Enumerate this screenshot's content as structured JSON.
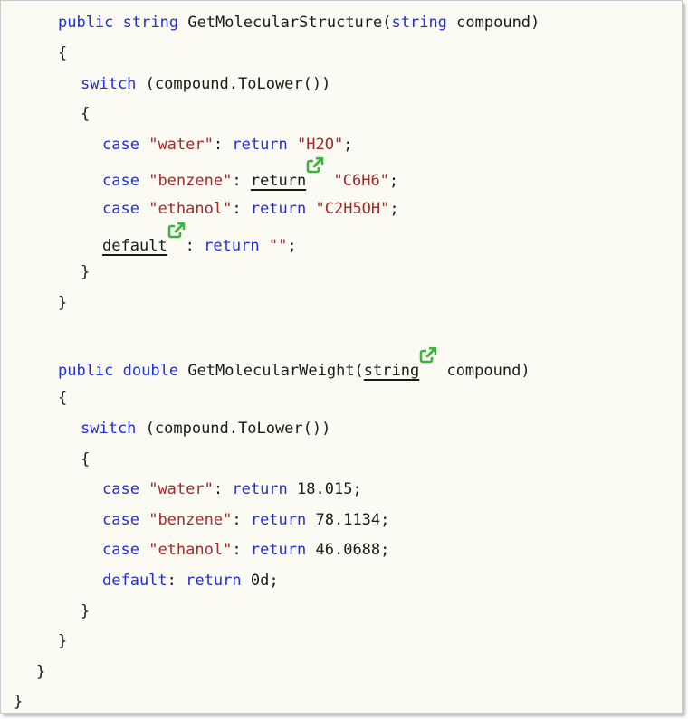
{
  "colors": {
    "keyword": "#1f2fd8",
    "string": "#a52a2a",
    "text": "#1a1a1a",
    "link_icon": "#3cb43c",
    "background": "#fcfbf3"
  },
  "code": {
    "l1": {
      "kw1": "public",
      "kw2": "string",
      "rest": " GetMolecularStructure(",
      "kw3": "string",
      "rest2": " compound)"
    },
    "l2": {
      "text": "{"
    },
    "l3": {
      "kw": "switch",
      "rest": " (compound.ToLower())"
    },
    "l4": {
      "text": "{"
    },
    "l5": {
      "kw_case": "case",
      "str": "\"water\"",
      "colon": ":",
      "kw_ret": "return",
      "val": "\"H2O\"",
      "end": ";"
    },
    "l6": {
      "kw_case": "case",
      "str": "\"benzene\"",
      "colon": ":",
      "kw_ret": "return",
      "val": "\"C6H6\"",
      "end": ";"
    },
    "l7": {
      "kw_case": "case",
      "str": "\"ethanol\"",
      "colon": ":",
      "kw_ret": "return",
      "val": "\"C2H5OH\"",
      "end": ";"
    },
    "l8": {
      "kw_default": "default",
      "colon": ":",
      "kw_ret": "return",
      "val": "\"\"",
      "end": ";"
    },
    "l9": {
      "text": "}"
    },
    "l10": {
      "text": "}"
    },
    "l11": {
      "kw1": "public",
      "kw2": "double",
      "rest": " GetMolecularWeight(",
      "kw3": "string",
      "rest2": " compound)"
    },
    "l12": {
      "text": "{"
    },
    "l13": {
      "kw": "switch",
      "rest": " (compound.ToLower())"
    },
    "l14": {
      "text": "{"
    },
    "l15": {
      "kw_case": "case",
      "str": "\"water\"",
      "colon": ":",
      "kw_ret": "return",
      "val": "18.015",
      "end": ";"
    },
    "l16": {
      "kw_case": "case",
      "str": "\"benzene\"",
      "colon": ":",
      "kw_ret": "return",
      "val": "78.1134",
      "end": ";"
    },
    "l17": {
      "kw_case": "case",
      "str": "\"ethanol\"",
      "colon": ":",
      "kw_ret": "return",
      "val": "46.0688",
      "end": ";"
    },
    "l18": {
      "kw_default": "default",
      "colon": ":",
      "kw_ret": "return",
      "val": "0d",
      "end": ";"
    },
    "l19": {
      "text": "}"
    },
    "l20": {
      "text": "}"
    },
    "l21": {
      "text": "}"
    },
    "l22": {
      "text": "}"
    }
  }
}
